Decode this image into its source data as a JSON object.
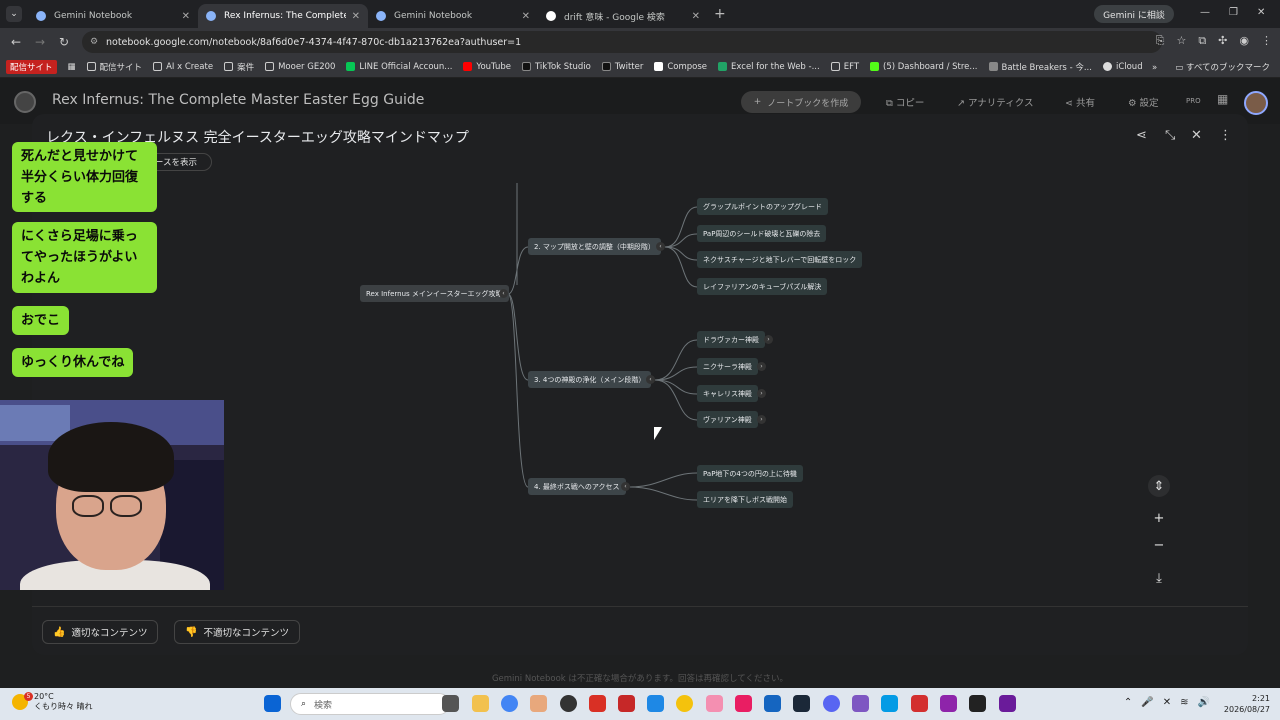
{
  "browser": {
    "tabs": [
      {
        "title": "Gemini Notebook",
        "color": "#8ab4f8"
      },
      {
        "title": "Rex Infernus: The Complete Ma",
        "color": "#8ab4f8"
      },
      {
        "title": "Gemini Notebook",
        "color": "#8ab4f8"
      },
      {
        "title": "drift 意味 - Google 検索",
        "color": "#ffffff"
      }
    ],
    "gemini_button": "Gemini に相談",
    "url": "notebook.google.com/notebook/8af6d0e7-4374-4f47-870c-db1a213762ea?authuser=1",
    "bookmarks": [
      "配信サイト",
      "配信サイト",
      "AI x Create",
      "案件",
      "Mooer GE200",
      "LINE Official Accoun...",
      "YouTube",
      "TikTok Studio",
      "Twitter",
      "Compose",
      "Excel for the Web -...",
      "EFT",
      "(5) Dashboard / Stre...",
      "Battle Breakers - 今...",
      "iCloud"
    ],
    "bookmarks_all": "すべてのブックマーク"
  },
  "app": {
    "title": "Rex Infernus: The Complete Master Easter Egg Guide",
    "create_button": "ノートブックを作成",
    "copy": "コピー",
    "analytics": "アナリティクス",
    "share": "共有",
    "settings": "設定",
    "pro": "PRO"
  },
  "modal": {
    "title": "レクス・インフェルヌス 完全イースターエッグ攻略マインドマップ",
    "show_sources": "ースを表示",
    "good": "適切なコンテンツ",
    "bad": "不適切なコンテンツ"
  },
  "mindmap": {
    "root": "Rex Infernus メインイースターエッグ攻略",
    "b2": {
      "label": "2. マップ開放と壁の調整（中期段階）",
      "children": [
        "グラップルポイントのアップグレード",
        "PaP周辺のシールド破壊と瓦礫の除去",
        "ネクサスチャージと地下レバーで回転壁をロック",
        "レイファリアンのキューブパズル解決"
      ]
    },
    "b3": {
      "label": "3. 4つの神殿の浄化（メイン段階）",
      "children": [
        "ドラヴァカー神殿",
        "ニクサーラ神殿",
        "キャレリス神殿",
        "ヴァリアン神殿"
      ]
    },
    "b4": {
      "label": "4. 最終ボス戦へのアクセス",
      "children": [
        "PaP地下の4つの円の上に待機",
        "エリアを降下しボス戦開始"
      ]
    }
  },
  "chat": [
    "死んだと見せかけて半分くらい体力回復する",
    "にくさら足場に乗ってやったほうがよいわよん",
    "おでこ",
    "ゆっくり休んでね"
  ],
  "footer_note": "Gemini Notebook は不正確な場合があります。回答は再確認してください。",
  "taskbar": {
    "temp": "20°C",
    "weather": "くもり時々 晴れ",
    "badge": "5",
    "search": "検索",
    "time": "2:21",
    "date": "2026/08/27"
  }
}
